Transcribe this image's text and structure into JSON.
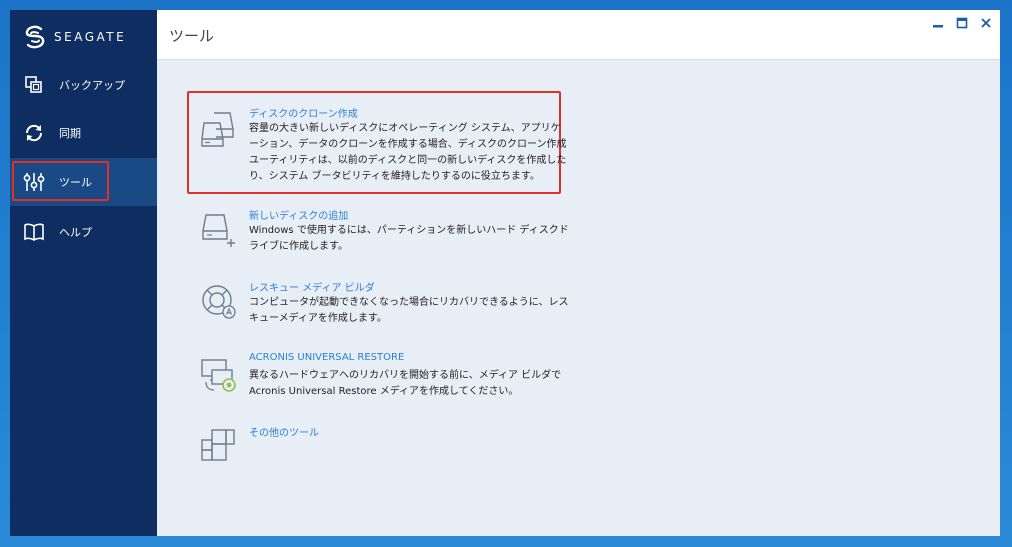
{
  "brand": {
    "name": "SEAGATE"
  },
  "sidebar": {
    "items": [
      {
        "label": "バックアップ",
        "icon": "copy-icon"
      },
      {
        "label": "同期",
        "icon": "sync-icon"
      },
      {
        "label": "ツール",
        "icon": "tools-sliders-icon"
      },
      {
        "label": "ヘルプ",
        "icon": "book-icon"
      }
    ]
  },
  "header": {
    "title": "ツール"
  },
  "window_controls": [
    "minimize",
    "maximize",
    "close"
  ],
  "tools": [
    {
      "name": "ディスクのクローン作成",
      "description": "容量の大きい新しいディスクにオペレーティング システム、アプリケーション、データのクローンを作成する場合、ディスクのクローン作成ユーティリティは、以前のディスクと同一の新しいディスクを作成したり、システム ブータビリティを維持したりするのに役立ちます。",
      "icon": "disk-clone-icon"
    },
    {
      "name": "新しいディスクの追加",
      "description": "Windows で使用するには、パーティションを新しいハード ディスクドライブに作成します。",
      "icon": "add-disk-icon"
    },
    {
      "name": "レスキュー メディア ビルダ",
      "description": "コンピュータが起動できなくなった場合にリカバリできるように、レスキューメディアを作成します。",
      "icon": "lifebuoy-icon"
    },
    {
      "name": "ACRONIS UNIVERSAL RESTORE",
      "description": "異なるハードウェアへのリカバリを開始する前に、メディア ビルダで Acronis Universal Restore メディアを作成してください。",
      "icon": "universal-restore-icon"
    },
    {
      "name": "その他のツール",
      "description": "",
      "icon": "grid-icon"
    }
  ],
  "colors": {
    "sidebar": "#0e2d60",
    "active": "#1a4a86",
    "link": "#2a7fd4",
    "highlight": "#e0302a",
    "content": "#e8eef6"
  }
}
